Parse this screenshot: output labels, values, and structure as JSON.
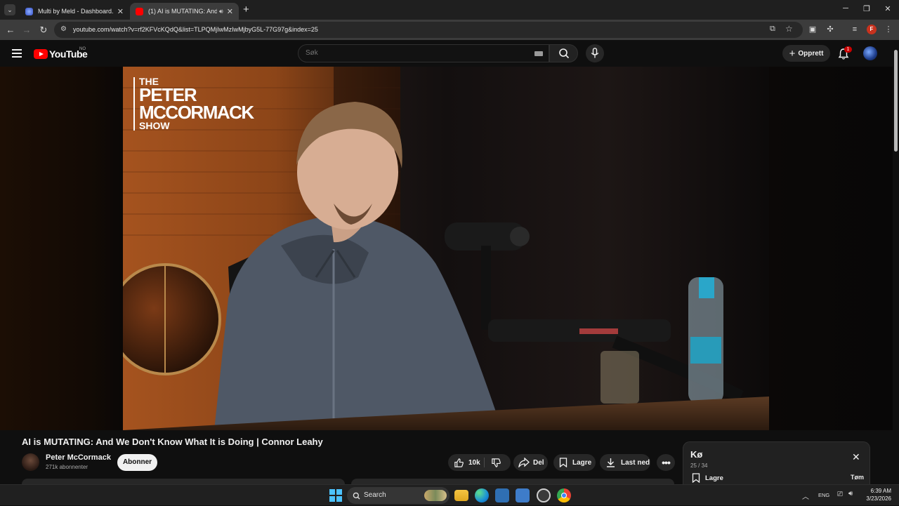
{
  "browser": {
    "tabs": [
      {
        "title": "Multi by Meld - Dashboard.",
        "active": false
      },
      {
        "title": "(1) AI is MUTATING: And We Don't Know What It is Doing",
        "active": true
      }
    ],
    "url": "youtube.com/watch?v=rf2KFVcKQdQ&list=TLPQMjIwMzIwMjbyG5L-77G97g&index=25",
    "profile_initial": "F"
  },
  "youtube": {
    "logo_text": "YouTube",
    "region": "NO",
    "search_placeholder": "Søk",
    "create_label": "Opprett",
    "notification_count": "1"
  },
  "video": {
    "overlay_brand": {
      "line1": "THE",
      "line2": "PETER",
      "line3": "MCCORMACK",
      "line4": "SHOW"
    },
    "title": "AI is MUTATING: And We Don't Know What It is Doing | Connor Leahy",
    "channel_name": "Peter McCormack",
    "subscribers": "271k abonnenter",
    "subscribe_label": "Abonner",
    "like_count": "10k",
    "share_label": "Del",
    "save_label": "Lagre",
    "download_label": "Last ned"
  },
  "queue": {
    "title": "Kø",
    "count": "25 / 34",
    "save_label": "Lagre",
    "clear_label": "Tøm"
  },
  "taskbar": {
    "search_label": "Search",
    "language": "ENG",
    "time": "6:39 AM",
    "date": "3/23/2026"
  },
  "colors": {
    "youtube_red": "#ff0000",
    "page_bg": "#0f0f0f",
    "pill_bg": "#272727"
  }
}
